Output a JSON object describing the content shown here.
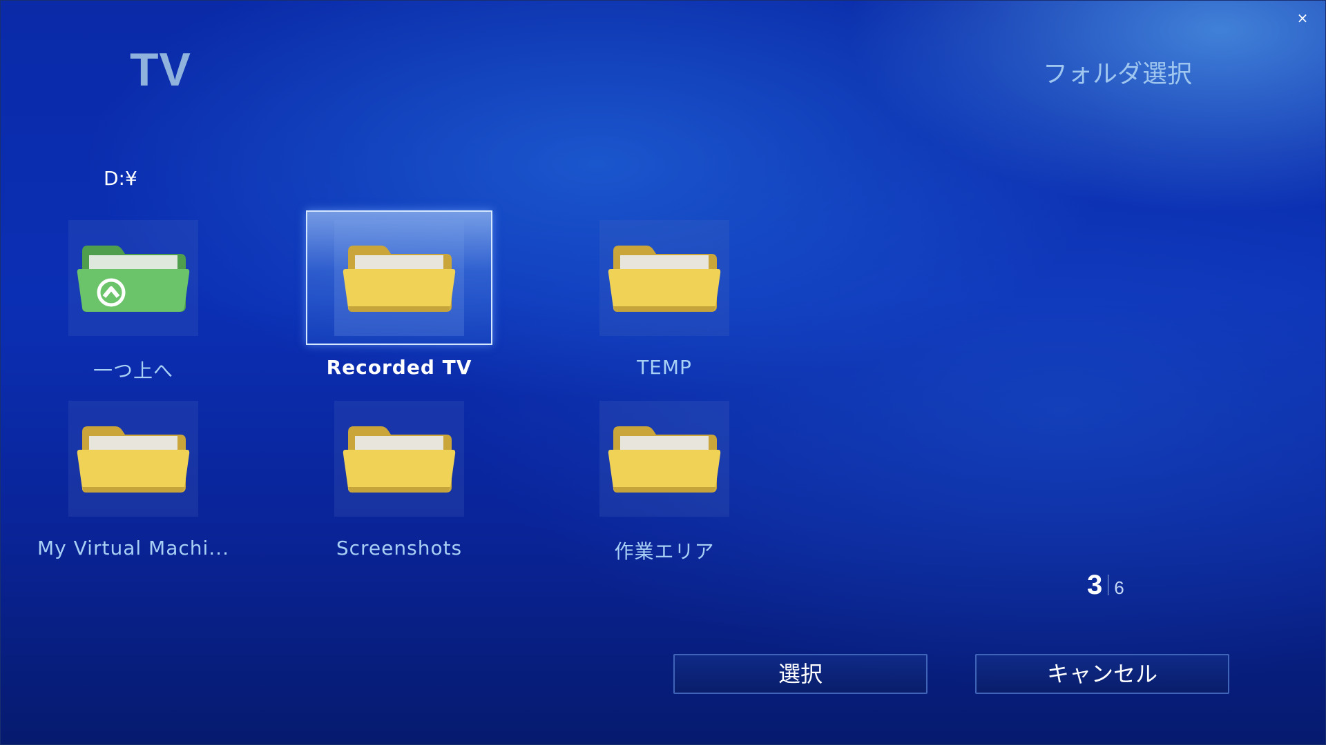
{
  "window": {
    "close_symbol": "×"
  },
  "header": {
    "app_title": "TV",
    "page_title": "フォルダ選択"
  },
  "path": "D:¥",
  "folders": [
    {
      "label": "一つ上へ",
      "icon": "folder-up-icon",
      "color": "#6cc46a",
      "selected": false
    },
    {
      "label": "Recorded TV",
      "icon": "folder-icon",
      "color": "#f0d257",
      "selected": true
    },
    {
      "label": "TEMP",
      "icon": "folder-icon",
      "color": "#f0d257",
      "selected": false
    },
    {
      "label": "My Virtual Machi...",
      "icon": "folder-icon",
      "color": "#f0d257",
      "selected": false
    },
    {
      "label": "Screenshots",
      "icon": "folder-icon",
      "color": "#f0d257",
      "selected": false
    },
    {
      "label": "作業エリア",
      "icon": "folder-icon",
      "color": "#f0d257",
      "selected": false
    }
  ],
  "pager": {
    "current": "3",
    "total": "6"
  },
  "buttons": {
    "select": "選択",
    "cancel": "キャンセル"
  }
}
